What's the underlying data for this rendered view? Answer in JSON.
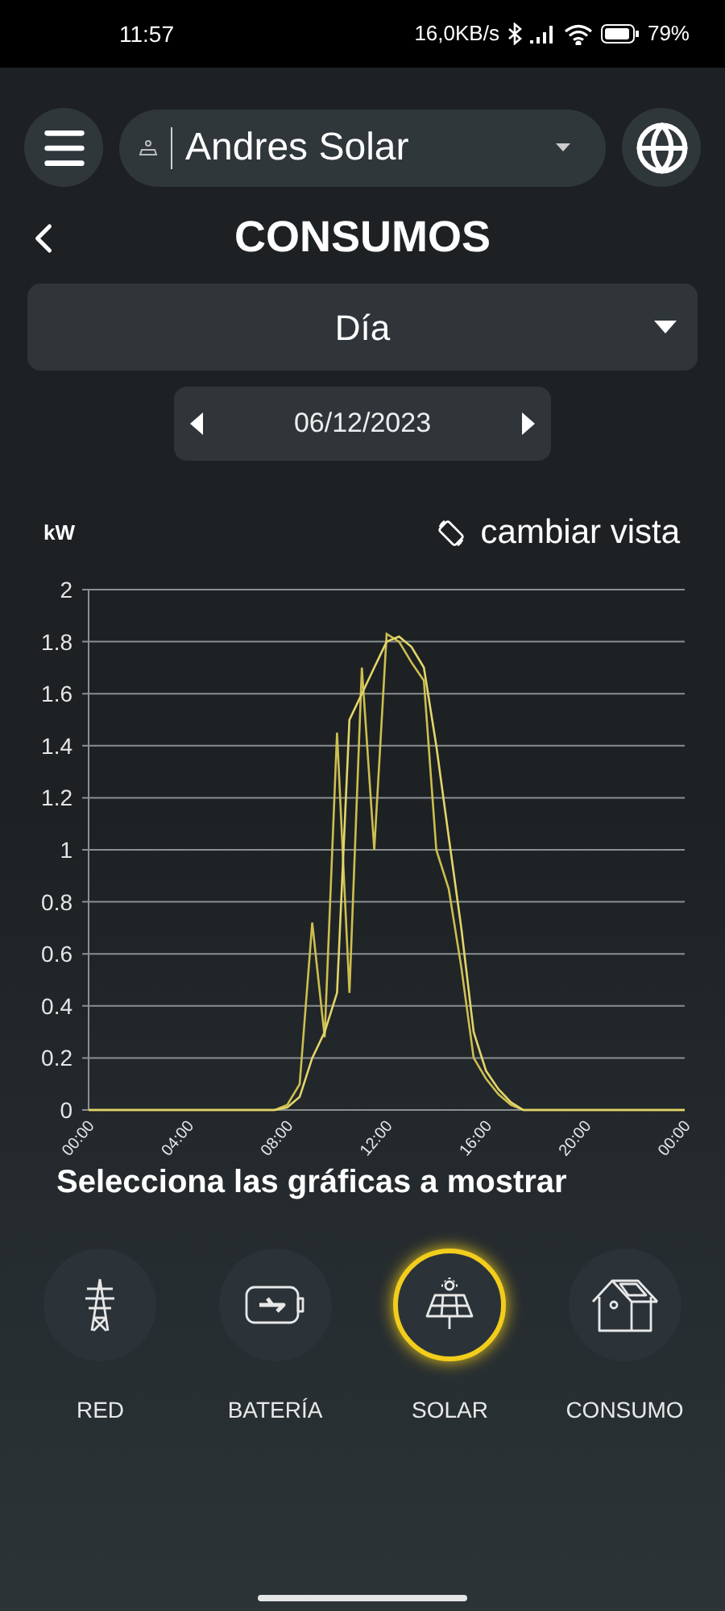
{
  "status_bar": {
    "time": "11:57",
    "network_speed": "16,0KB/s",
    "battery": "79%"
  },
  "header": {
    "site_selector": {
      "value": "Andres Solar"
    }
  },
  "page_title": "CONSUMOS",
  "period_select": {
    "value": "Día"
  },
  "date_picker": {
    "value": "06/12/2023"
  },
  "view_toggle": "cambiar vista",
  "chart_data": {
    "type": "line",
    "grid": true,
    "ylabel": "kW",
    "x": [
      0,
      0.5,
      1,
      1.5,
      2,
      2.5,
      3,
      3.5,
      4,
      4.5,
      5,
      5.5,
      6,
      6.5,
      7,
      7.5,
      8,
      8.5,
      9,
      9.5,
      10,
      10.5,
      11,
      11.5,
      12,
      12.5,
      13,
      13.5,
      14,
      14.5,
      15,
      15.5,
      16,
      16.5,
      17,
      17.5,
      18,
      18.5,
      19,
      19.5,
      20,
      20.5,
      21,
      21.5,
      22,
      22.5,
      23,
      23.5,
      24
    ],
    "series": [
      {
        "color": "#cdbf4f",
        "values": [
          0,
          0,
          0,
          0,
          0,
          0,
          0,
          0,
          0,
          0,
          0,
          0,
          0,
          0,
          0,
          0,
          0.02,
          0.1,
          0.72,
          0.28,
          1.45,
          0.45,
          1.7,
          1.0,
          1.83,
          1.8,
          1.72,
          1.65,
          1.0,
          0.85,
          0.55,
          0.2,
          0.12,
          0.06,
          0.02,
          0,
          0,
          0,
          0,
          0,
          0,
          0,
          0,
          0,
          0,
          0,
          0,
          0,
          0
        ]
      },
      {
        "color": "#e3d56a",
        "values": [
          0,
          0,
          0,
          0,
          0,
          0,
          0,
          0,
          0,
          0,
          0,
          0,
          0,
          0,
          0,
          0,
          0.01,
          0.05,
          0.2,
          0.3,
          0.45,
          1.5,
          1.6,
          1.7,
          1.8,
          1.82,
          1.78,
          1.7,
          1.4,
          1.05,
          0.7,
          0.3,
          0.15,
          0.08,
          0.03,
          0,
          0,
          0,
          0,
          0,
          0,
          0,
          0,
          0,
          0,
          0,
          0,
          0,
          0
        ]
      }
    ],
    "xlim": [
      0,
      24
    ],
    "ylim": [
      0,
      2
    ],
    "xticks": [
      {
        "value": 0,
        "label": "00:00"
      },
      {
        "value": 4,
        "label": "04:00"
      },
      {
        "value": 8,
        "label": "08:00"
      },
      {
        "value": 12,
        "label": "12:00"
      },
      {
        "value": 16,
        "label": "16:00"
      },
      {
        "value": 20,
        "label": "20:00"
      },
      {
        "value": 24,
        "label": "00:00"
      }
    ],
    "yticks": [
      0,
      {
        "value": 0.2,
        "label": "0.2"
      },
      {
        "value": 0.4,
        "label": "0.4"
      },
      {
        "value": 0.6,
        "label": "0.6"
      },
      {
        "value": 0.8,
        "label": "0.8"
      },
      1,
      {
        "value": 1.2,
        "label": "1.2"
      },
      {
        "value": 1.4,
        "label": "1.4"
      },
      {
        "value": 1.6,
        "label": "1.6"
      },
      {
        "value": 1.8,
        "label": "1.8"
      },
      2
    ]
  },
  "section_title": "Selecciona las gráficas a mostrar",
  "series_buttons": [
    {
      "kind": "grid",
      "label": "RED",
      "selected": false
    },
    {
      "kind": "battery",
      "label": "BATERÍA",
      "selected": false
    },
    {
      "kind": "solar",
      "label": "SOLAR",
      "selected": true
    },
    {
      "kind": "consumption",
      "label": "CONSUMO",
      "selected": false
    }
  ]
}
